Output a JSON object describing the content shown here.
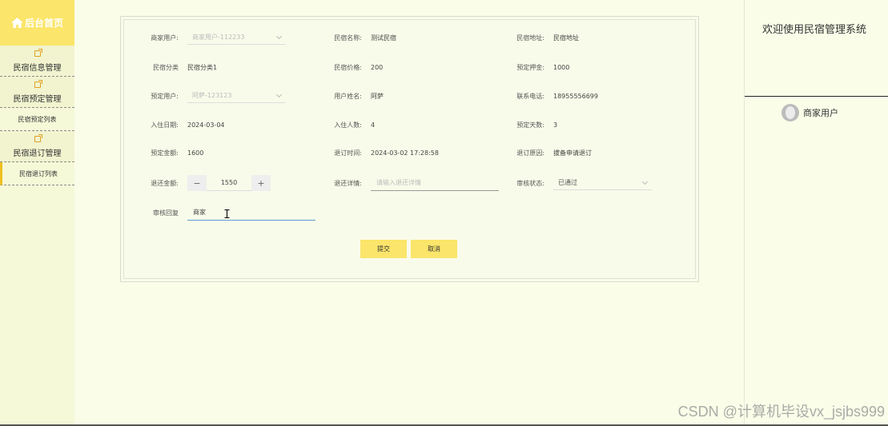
{
  "sidebar": {
    "home_label": "后台首页",
    "groups": [
      {
        "label": "民宿信息管理"
      },
      {
        "label": "民宿预定管理",
        "subs": [
          "民宿预定列表"
        ]
      },
      {
        "label": "民宿退订管理",
        "subs": [
          "民宿退订列表"
        ]
      }
    ]
  },
  "form": {
    "merchant_user": {
      "label": "商家用户:",
      "value": "商家用户-112233"
    },
    "homestay_name": {
      "label": "民宿名称:",
      "value": "测试民宿"
    },
    "homestay_address": {
      "label": "民宿地址:",
      "value": "民宿地址"
    },
    "homestay_category": {
      "label": "民宿分类",
      "value": "民宿分类1"
    },
    "homestay_price": {
      "label": "民宿价格:",
      "value": "200"
    },
    "booking_deposit": {
      "label": "预定押金:",
      "value": "1000"
    },
    "booking_user": {
      "label": "预定用户:",
      "value": "阿萨-123123"
    },
    "user_name": {
      "label": "用户姓名:",
      "value": "阿萨"
    },
    "contact_phone": {
      "label": "联系电话:",
      "value": "18955556699"
    },
    "checkin_date": {
      "label": "入住日期:",
      "value": "2024-03-04"
    },
    "guests": {
      "label": "入住人数:",
      "value": "4"
    },
    "booking_days": {
      "label": "预定天数:",
      "value": "3"
    },
    "booking_amount": {
      "label": "预定金额:",
      "value": "1600"
    },
    "cancel_time": {
      "label": "退订时间:",
      "value": "2024-03-02 17:28:58"
    },
    "cancel_reason": {
      "label": "退订原因:",
      "value": "拔备申请退订"
    },
    "refund_amount": {
      "label": "退还金额:",
      "value": "1550",
      "minus": "−",
      "plus": "+"
    },
    "refund_detail": {
      "label": "退还详情:",
      "placeholder": "请输入退还详情"
    },
    "review_status": {
      "label": "审核状态:",
      "value": "已通过"
    },
    "review_reply": {
      "label": "审核回复",
      "value": "商家"
    },
    "submit_label": "提交",
    "cancel_label": "取消"
  },
  "header": {
    "welcome": "欢迎使用民宿管理系统",
    "user_role": "商家用户"
  },
  "watermark": "CSDN @计算机毕设vx_jsjbs999",
  "colors": {
    "accent": "#fbe56a",
    "sidebar_bg": "#f6f9d8",
    "page_bg": "#fafde8"
  }
}
